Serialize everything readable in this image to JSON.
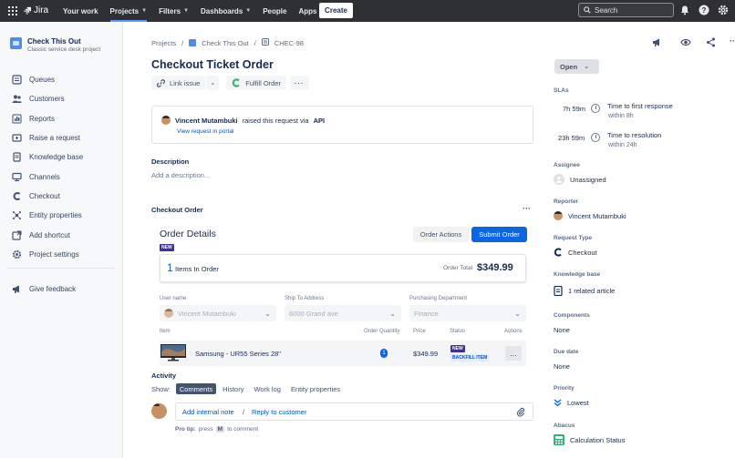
{
  "topbar": {
    "product": "Jira",
    "nav": [
      {
        "label": "Your work",
        "has_chevron": false
      },
      {
        "label": "Projects",
        "has_chevron": true,
        "active": true
      },
      {
        "label": "Filters",
        "has_chevron": true
      },
      {
        "label": "Dashboards",
        "has_chevron": true
      },
      {
        "label": "People",
        "has_chevron": false
      },
      {
        "label": "Apps",
        "has_chevron": true
      }
    ],
    "create_label": "Create",
    "search_placeholder": "Search",
    "icons": [
      "app-switcher-icon",
      "notifications-bell-icon",
      "help-icon",
      "settings-gear-icon"
    ]
  },
  "sidebar": {
    "project_name": "Check This Out",
    "project_type": "Classic service desk project",
    "items": [
      {
        "label": "Queues",
        "icon": "queues-icon"
      },
      {
        "label": "Customers",
        "icon": "customers-icon"
      },
      {
        "label": "Reports",
        "icon": "reports-icon"
      },
      {
        "label": "Raise a request",
        "icon": "raise-request-icon"
      },
      {
        "label": "Knowledge base",
        "icon": "knowledge-base-icon"
      },
      {
        "label": "Channels",
        "icon": "channels-icon"
      },
      {
        "label": "Checkout",
        "icon": "checkout-icon"
      },
      {
        "label": "Entity properties",
        "icon": "entity-properties-icon"
      },
      {
        "label": "Add shortcut",
        "icon": "add-shortcut-icon"
      },
      {
        "label": "Project settings",
        "icon": "project-settings-icon"
      }
    ],
    "feedback": "Give feedback"
  },
  "breadcrumb": {
    "projects": "Projects",
    "project": "Check This Out",
    "issue_key": "CHEC-98"
  },
  "issue": {
    "title": "Checkout Ticket Order",
    "link_issue": "Link issue",
    "fulfill_order": "Fulfill Order",
    "reporter_name": "Vincent Mutambuki",
    "raised_text": "raised this request via",
    "channel": "API",
    "view_portal": "View request in portal",
    "description_label": "Description",
    "description_placeholder": "Add a description...",
    "checkout_label": "Checkout Order"
  },
  "order": {
    "title": "Order Details",
    "badge": "NEW",
    "order_actions": "Order Actions",
    "submit_order": "Submit Order",
    "items_count": "1",
    "items_label": "Items In Order",
    "total_label": "Order Total",
    "total_value": "$349.99",
    "fields": [
      {
        "label": "User name",
        "value": "Vincent Mutambuki"
      },
      {
        "label": "Ship To Address",
        "value": "6000 Grand ave"
      },
      {
        "label": "Purchasing Department",
        "value": "Finance"
      }
    ],
    "columns": [
      "Item",
      "Order Quantity",
      "Price",
      "Status",
      "Actions"
    ],
    "rows": [
      {
        "item": "Samsung - UR55 Series 28\"",
        "quantity": "1",
        "price": "$349.99",
        "status_new": "NEW",
        "status": "BACKFILL ITEM",
        "actions": "..."
      }
    ]
  },
  "activity": {
    "label": "Activity",
    "show": "Show:",
    "tabs": [
      "Comments",
      "History",
      "Work log",
      "Entity properties"
    ],
    "add_note": "Add internal note",
    "separator": "/",
    "reply": "Reply to customer",
    "pro_tip_bold": "Pro tip:",
    "pro_tip_press": "press",
    "pro_tip_key": "M",
    "pro_tip_rest": "to comment"
  },
  "details": {
    "status": "Open",
    "slas_label": "SLAs",
    "slas": [
      {
        "time": "7h 59m",
        "title": "Time to first response",
        "target": "within 8h"
      },
      {
        "time": "23h 59m",
        "title": "Time to resolution",
        "target": "within 24h"
      }
    ],
    "assignee_label": "Assignee",
    "assignee": "Unassigned",
    "reporter_label": "Reporter",
    "reporter": "Vincent Mutambuki",
    "request_type_label": "Request Type",
    "request_type": "Checkout",
    "kb_label": "Knowledge base",
    "kb_value": "1 related article",
    "components_label": "Components",
    "components": "None",
    "due_label": "Due date",
    "due": "None",
    "priority_label": "Priority",
    "priority": "Lowest",
    "abacus_label": "Abacus",
    "abacus": "Calculation Status"
  },
  "colors": {
    "topbar": "#2f3034",
    "primary": "#0c66e4",
    "badge": "#403294",
    "backfill": "#0052cc"
  }
}
